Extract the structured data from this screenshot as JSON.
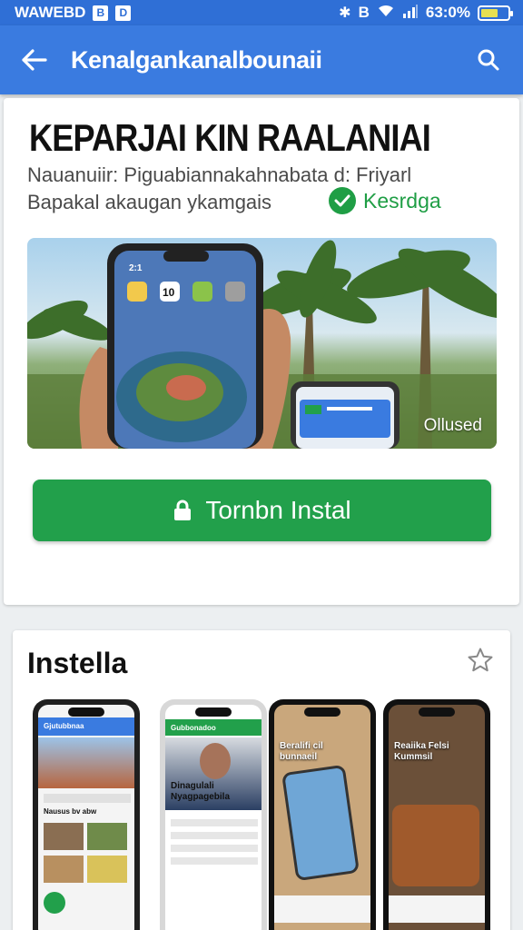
{
  "status_bar": {
    "carrier": "WAWEBD",
    "icon1": "B",
    "icon2": "D",
    "signal_text": "B",
    "battery_text": "63:0%",
    "battery_level": 0.63
  },
  "app_bar": {
    "title": "Kenalgankanalbounaii",
    "back_icon": "arrow-left-icon",
    "search_icon": "search-icon"
  },
  "hero": {
    "title": "KEPARJAI KIN RAALANIAI",
    "subtitle_line1": "Nauanuiir: Piguabiannakahnabata d: Friyarl",
    "subtitle_line2": "Bapakal akaugan ykamgais",
    "verified_label": "Kesrdga",
    "banner_label": "Ollused",
    "phone_time": "2:1",
    "phone_badge": "10"
  },
  "install_button": {
    "label": "Tornbn Instal",
    "icon": "lock-icon",
    "color": "#22a04b"
  },
  "screenshots": {
    "title": "Instella",
    "star_icon": "star-outline-icon",
    "items": [
      {
        "header": "Gjutubbnaa",
        "caption": "Nausus bv abw"
      },
      {
        "header": "Gubbonadoo",
        "caption": "Dinagulali Nyagpagebila"
      },
      {
        "header": "",
        "caption": "Beralifi cil bunnaeil"
      },
      {
        "header": "",
        "caption": "Reaiika Felsi Kummsil"
      }
    ]
  },
  "colors": {
    "primary": "#3a7be0",
    "status_bar": "#2f6fd6",
    "accent_green": "#22a04b"
  }
}
